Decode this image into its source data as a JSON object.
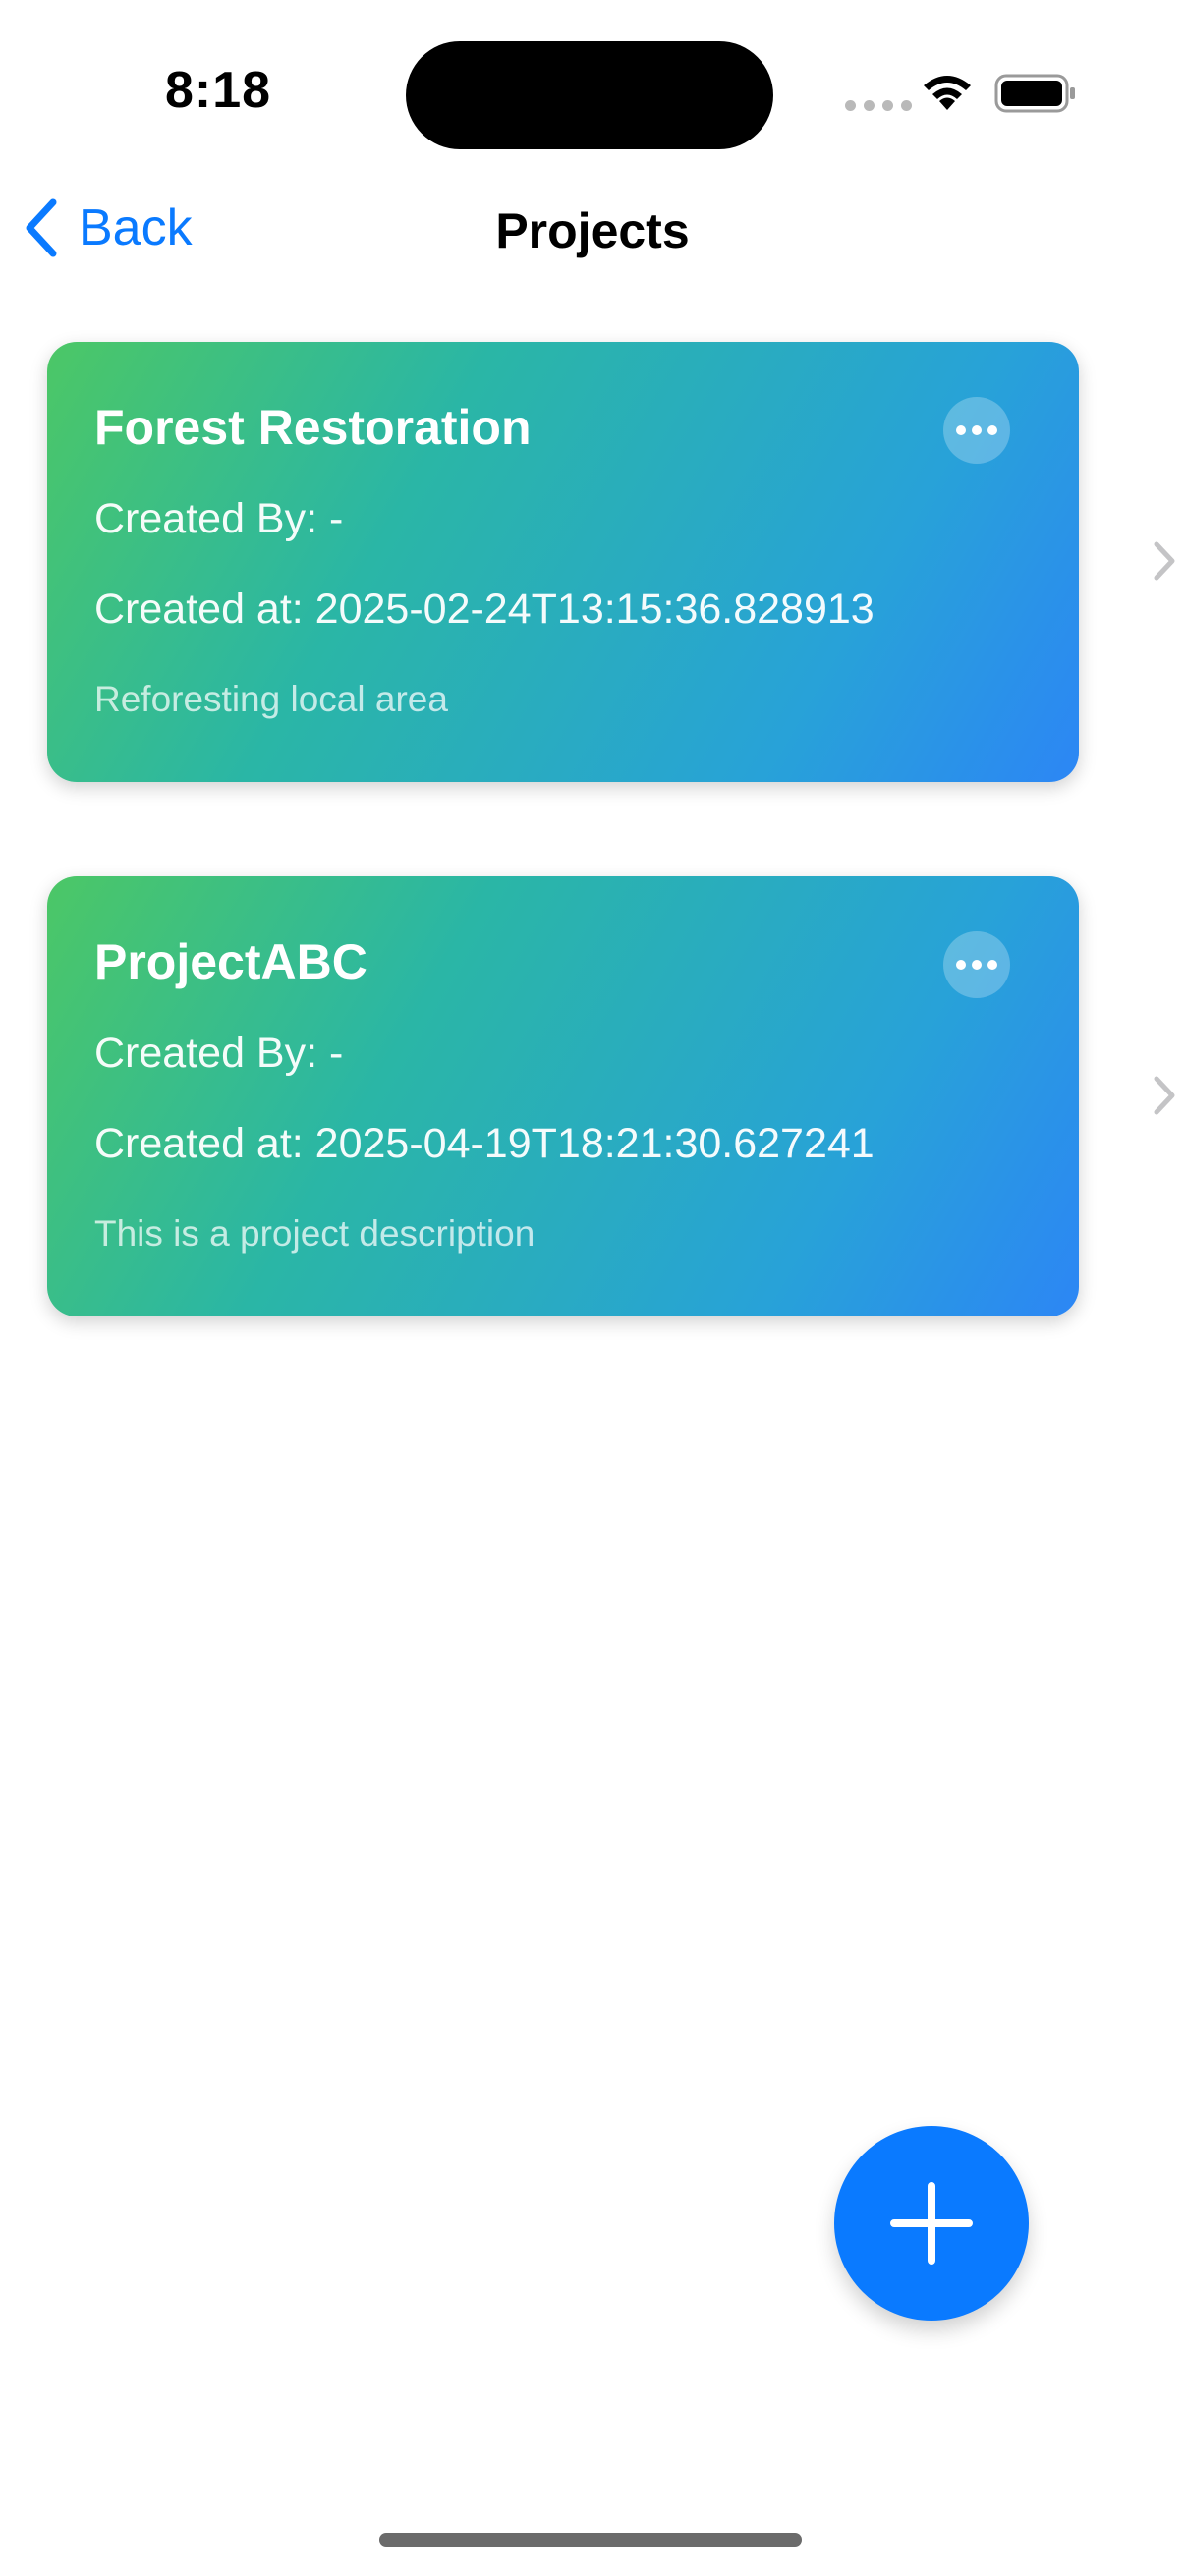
{
  "status_bar": {
    "time": "8:18"
  },
  "nav": {
    "back_label": "Back",
    "title": "Projects"
  },
  "projects": [
    {
      "name": "Forest Restoration",
      "created_by": "Created By: -",
      "created_at": "Created at: 2025-02-24T13:15:36.828913",
      "description": "Reforesting local area"
    },
    {
      "name": "ProjectABC",
      "created_by": "Created By: -",
      "created_at": "Created at: 2025-04-19T18:21:30.627241",
      "description": "This is a project description"
    }
  ],
  "icons": {
    "back": "chevron-left-icon",
    "more": "ellipsis-icon",
    "row": "chevron-right-icon",
    "add": "plus-icon"
  },
  "colors": {
    "accent": "#0a7aff",
    "card_gradient_start": "#4cc766",
    "card_gradient_end": "#2c86f5"
  }
}
